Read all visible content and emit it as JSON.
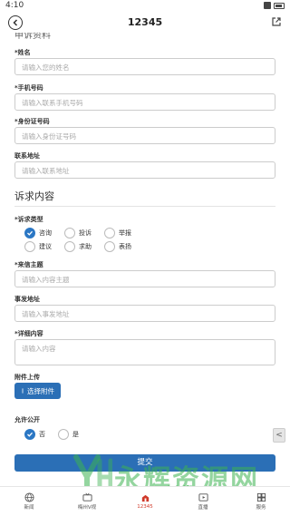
{
  "status_bar": {
    "time": "4:10"
  },
  "header": {
    "title": "12345"
  },
  "personal": {
    "section_partial": "申诉资料",
    "name_label": "*姓名",
    "name_placeholder": "请输入您的姓名",
    "phone_label": "*手机号码",
    "phone_placeholder": "请输入联系手机号码",
    "id_label": "*身份证号码",
    "id_placeholder": "请输入身份证号码",
    "address_label": "联系地址",
    "address_placeholder": "请输入联系地址"
  },
  "complaint": {
    "section_title": "诉求内容",
    "type_label": "*诉求类型",
    "types": [
      {
        "label": "咨询",
        "selected": true
      },
      {
        "label": "投诉",
        "selected": false
      },
      {
        "label": "举报",
        "selected": false
      },
      {
        "label": "建议",
        "selected": false
      },
      {
        "label": "求助",
        "selected": false
      },
      {
        "label": "表扬",
        "selected": false
      }
    ],
    "subject_label": "*来信主题",
    "subject_placeholder": "请输入内容主题",
    "location_label": "事发地址",
    "location_placeholder": "请输入事发地址",
    "detail_label": "*详细内容",
    "detail_placeholder": "请输入内容",
    "attachment_label": "附件上传",
    "attachment_button": "选择附件",
    "public_label": "允许公开",
    "public_options": [
      {
        "label": "否",
        "selected": true
      },
      {
        "label": "是",
        "selected": false
      }
    ],
    "submit_button": "提交",
    "side_arrow": "<"
  },
  "bottom_nav": [
    {
      "label": "新闻",
      "icon": "globe-icon",
      "active": false
    },
    {
      "label": "梅州V视",
      "icon": "tv-icon",
      "active": false
    },
    {
      "label": "12345",
      "icon": "hotline-icon",
      "active": true
    },
    {
      "label": "直播",
      "icon": "live-icon",
      "active": false
    },
    {
      "label": "服务",
      "icon": "service-icon",
      "active": false
    }
  ],
  "colors": {
    "primary": "#2b6fb6",
    "active_nav": "#d03a2a",
    "watermark": "#3cb250"
  },
  "watermark": {
    "text": "永辉资源网",
    "url": "yhkjjj.com"
  }
}
